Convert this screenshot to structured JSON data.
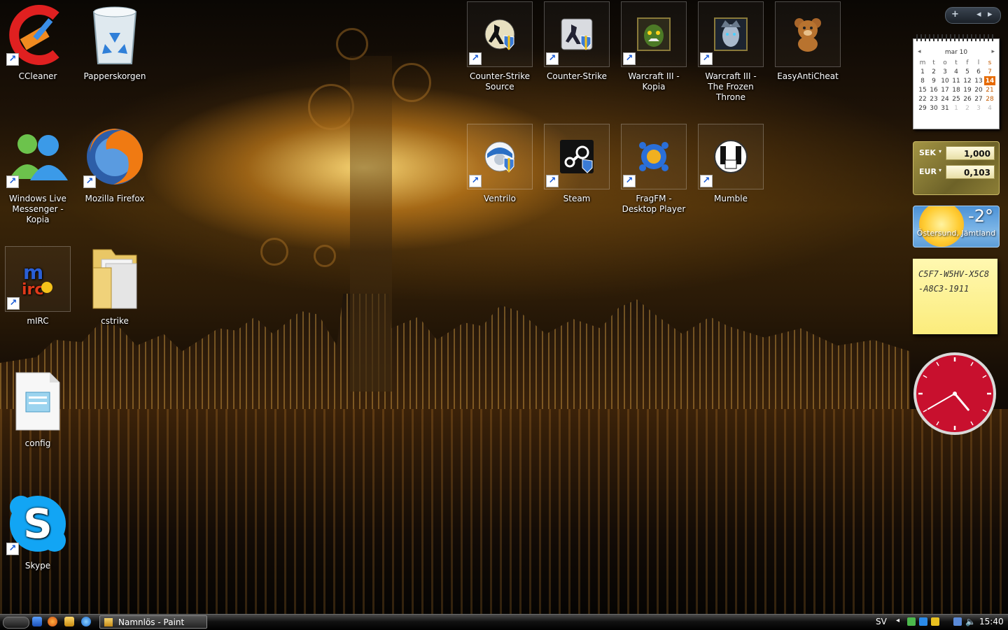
{
  "desktop": {
    "icons": [
      {
        "label": "CCleaner"
      },
      {
        "label": "Papperskorgen"
      },
      {
        "label": "Windows Live Messenger - Kopia"
      },
      {
        "label": "Mozilla Firefox"
      },
      {
        "label": "mIRC"
      },
      {
        "label": "cstrike"
      },
      {
        "label": "config"
      },
      {
        "label": "Skype"
      },
      {
        "label": "Counter-Strike Source"
      },
      {
        "label": "Counter-Strike"
      },
      {
        "label": "Warcraft III - Kopia"
      },
      {
        "label": "Warcraft III - The Frozen Throne"
      },
      {
        "label": "EasyAntiCheat"
      },
      {
        "label": "Ventrilo"
      },
      {
        "label": "Steam"
      },
      {
        "label": "FragFM - Desktop Player"
      },
      {
        "label": "Mumble"
      }
    ]
  },
  "sidebar_controls": {
    "add": "+",
    "prev": "◂",
    "next": "▸"
  },
  "calendar": {
    "month": "mar 10",
    "weekdays": [
      "m",
      "t",
      "o",
      "t",
      "f",
      "l",
      "s"
    ],
    "weeks": [
      [
        "1",
        "2",
        "3",
        "4",
        "5",
        "6",
        "7"
      ],
      [
        "8",
        "9",
        "10",
        "11",
        "12",
        "13",
        "14"
      ],
      [
        "15",
        "16",
        "17",
        "18",
        "19",
        "20",
        "21"
      ],
      [
        "22",
        "23",
        "24",
        "25",
        "26",
        "27",
        "28"
      ],
      [
        "29",
        "30",
        "31",
        "1",
        "2",
        "3",
        "4"
      ]
    ],
    "today": "14"
  },
  "currency": {
    "rows": [
      {
        "code": "SEK",
        "value": "1,000"
      },
      {
        "code": "EUR",
        "value": "0,103"
      }
    ]
  },
  "weather": {
    "temp": "-2°",
    "city": "Östersund, Jämtland"
  },
  "note": {
    "text": "C5F7-W5HV-X5C8-A8C3-1911"
  },
  "clock": {
    "hour": 4,
    "minute": 40
  },
  "taskbar": {
    "window_title": "Namnlös - Paint",
    "language": "SV",
    "time": "15:40"
  },
  "colors": {
    "accent": "#e66a00",
    "clock_face": "#c8102e"
  }
}
